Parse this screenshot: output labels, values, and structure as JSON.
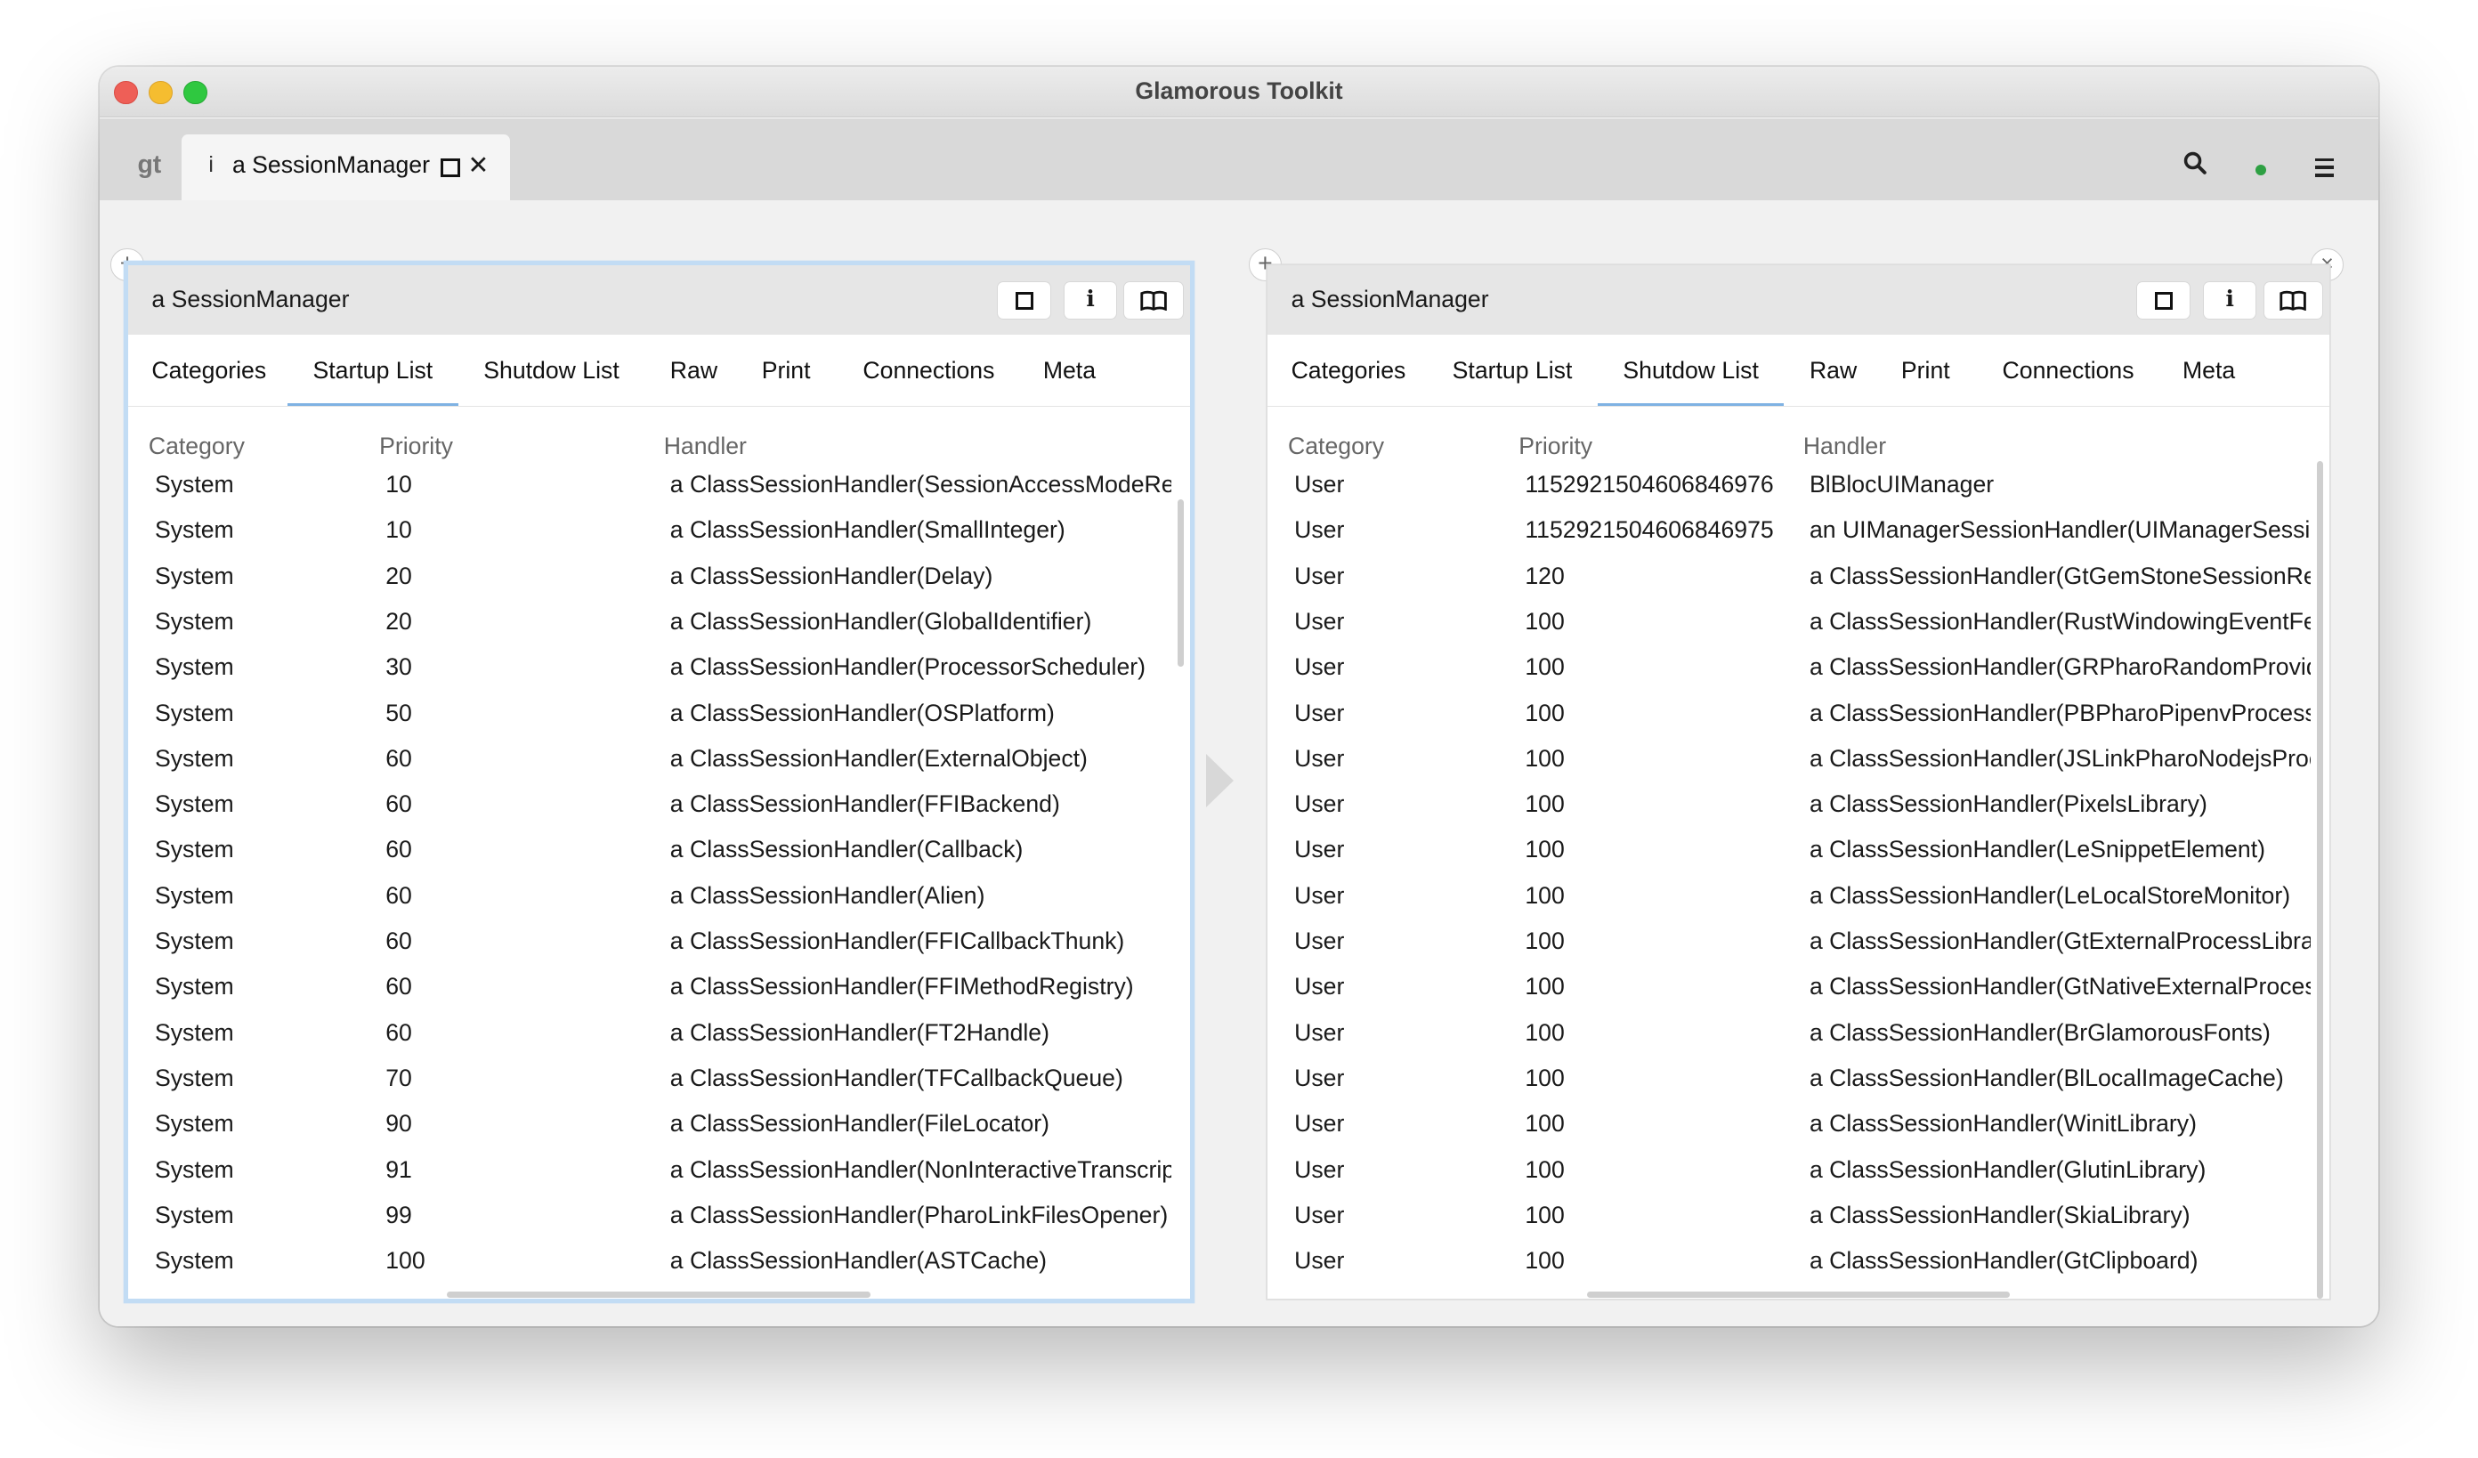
{
  "window": {
    "title": "Glamorous Toolkit"
  },
  "tabstrip": {
    "logo": "gt",
    "tab": {
      "icon": "i",
      "label": "a SessionManager"
    }
  },
  "left": {
    "title": "a SessionManager",
    "info_icon": "i",
    "tabs": [
      "Categories",
      "Startup List",
      "Shutdow List",
      "Raw",
      "Print",
      "Connections",
      "Meta"
    ],
    "active_tab": "Startup List",
    "columns": [
      "Category",
      "Priority",
      "Handler"
    ],
    "rows": [
      [
        "System",
        "10",
        "a ClassSessionHandler(SessionAccessModeReso"
      ],
      [
        "System",
        "10",
        "a ClassSessionHandler(SmallInteger)"
      ],
      [
        "System",
        "20",
        "a ClassSessionHandler(Delay)"
      ],
      [
        "System",
        "20",
        "a ClassSessionHandler(GlobalIdentifier)"
      ],
      [
        "System",
        "30",
        "a ClassSessionHandler(ProcessorScheduler)"
      ],
      [
        "System",
        "50",
        "a ClassSessionHandler(OSPlatform)"
      ],
      [
        "System",
        "60",
        "a ClassSessionHandler(ExternalObject)"
      ],
      [
        "System",
        "60",
        "a ClassSessionHandler(FFIBackend)"
      ],
      [
        "System",
        "60",
        "a ClassSessionHandler(Callback)"
      ],
      [
        "System",
        "60",
        "a ClassSessionHandler(Alien)"
      ],
      [
        "System",
        "60",
        "a ClassSessionHandler(FFICallbackThunk)"
      ],
      [
        "System",
        "60",
        "a ClassSessionHandler(FFIMethodRegistry)"
      ],
      [
        "System",
        "60",
        "a ClassSessionHandler(FT2Handle)"
      ],
      [
        "System",
        "70",
        "a ClassSessionHandler(TFCallbackQueue)"
      ],
      [
        "System",
        "90",
        "a ClassSessionHandler(FileLocator)"
      ],
      [
        "System",
        "91",
        "a ClassSessionHandler(NonInteractiveTranscript"
      ],
      [
        "System",
        "99",
        "a ClassSessionHandler(PharoLinkFilesOpener)"
      ],
      [
        "System",
        "100",
        "a ClassSessionHandler(ASTCache)"
      ]
    ]
  },
  "right": {
    "title": "a SessionManager",
    "info_icon": "i",
    "close_glyph": "×",
    "tabs": [
      "Categories",
      "Startup List",
      "Shutdow List",
      "Raw",
      "Print",
      "Connections",
      "Meta"
    ],
    "active_tab": "Shutdow List",
    "columns": [
      "Category",
      "Priority",
      "Handler"
    ],
    "rows": [
      [
        "User",
        "1152921504606846976",
        "BlBlocUIManager"
      ],
      [
        "User",
        "1152921504606846975",
        "an UIManagerSessionHandler(UIManagerSession"
      ],
      [
        "User",
        "120",
        "a ClassSessionHandler(GtGemStoneSessionRegi"
      ],
      [
        "User",
        "100",
        "a ClassSessionHandler(RustWindowingEventFet"
      ],
      [
        "User",
        "100",
        "a ClassSessionHandler(GRPharoRandomProvide"
      ],
      [
        "User",
        "100",
        "a ClassSessionHandler(PBPharoPipenvProcess)"
      ],
      [
        "User",
        "100",
        "a ClassSessionHandler(JSLinkPharoNodejsProce"
      ],
      [
        "User",
        "100",
        "a ClassSessionHandler(PixelsLibrary)"
      ],
      [
        "User",
        "100",
        "a ClassSessionHandler(LeSnippetElement)"
      ],
      [
        "User",
        "100",
        "a ClassSessionHandler(LeLocalStoreMonitor)"
      ],
      [
        "User",
        "100",
        "a ClassSessionHandler(GtExternalProcessLibrary"
      ],
      [
        "User",
        "100",
        "a ClassSessionHandler(GtNativeExternalProcess"
      ],
      [
        "User",
        "100",
        "a ClassSessionHandler(BrGlamorousFonts)"
      ],
      [
        "User",
        "100",
        "a ClassSessionHandler(BlLocalImageCache)"
      ],
      [
        "User",
        "100",
        "a ClassSessionHandler(WinitLibrary)"
      ],
      [
        "User",
        "100",
        "a ClassSessionHandler(GlutinLibrary)"
      ],
      [
        "User",
        "100",
        "a ClassSessionHandler(SkiaLibrary)"
      ],
      [
        "User",
        "100",
        "a ClassSessionHandler(GtClipboard)"
      ]
    ]
  },
  "icons": [
    "close-icon",
    "minimize-icon",
    "maximize-icon",
    "search-icon",
    "status-dot-icon",
    "hamburger-menu-icon",
    "add-icon",
    "inspect-icon",
    "info-icon",
    "book-icon",
    "arrow-right-icon"
  ],
  "colors": {
    "accent": "#7fb2e3",
    "focus_ring": "#c2dcf4",
    "status_dot": "#2ea043"
  }
}
